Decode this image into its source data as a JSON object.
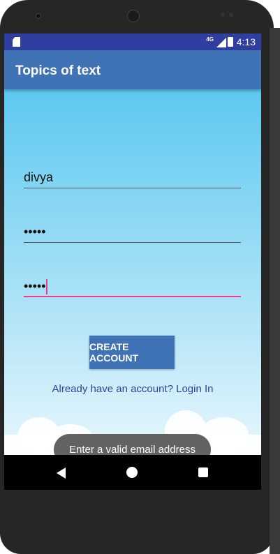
{
  "status_bar": {
    "network": "4G",
    "time": "4:13"
  },
  "app_bar": {
    "title": "Topics of text"
  },
  "form": {
    "username_value": "divya",
    "password_value": "•••••",
    "confirm_password_value": "•••••",
    "create_account_label": "CREATE ACCOUNT",
    "login_link": "Already have an account? Login In"
  },
  "toast": {
    "message": "Enter a valid email address"
  },
  "colors": {
    "status_bar": "#303f9f",
    "app_bar": "#3f73b5",
    "accent": "#e83e8c",
    "button": "#3f73b5"
  }
}
